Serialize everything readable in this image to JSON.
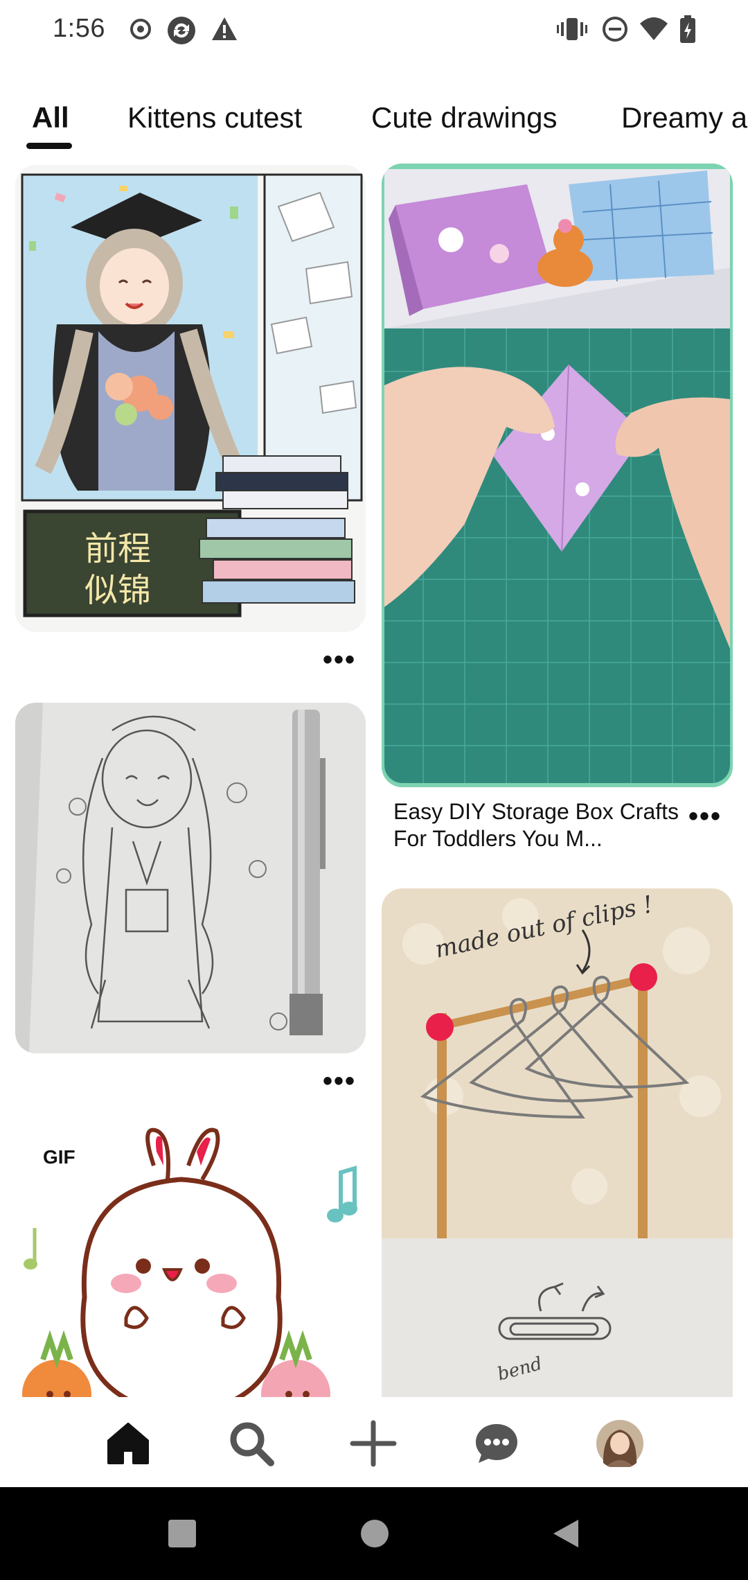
{
  "status_bar": {
    "time": "1:56",
    "left_icons": [
      "record-icon",
      "sync-icon",
      "warning-icon"
    ],
    "right_icons": [
      "vibrate-icon",
      "do-not-disturb-icon",
      "wifi-icon",
      "battery-icon"
    ]
  },
  "tabs": [
    {
      "label": "All",
      "selected": true
    },
    {
      "label": "Kittens cutest",
      "selected": false
    },
    {
      "label": "Cute drawings",
      "selected": false
    },
    {
      "label": "Dreamy a",
      "selected": false
    }
  ],
  "pins": [
    {
      "id": "graduation-illustration",
      "column": "left",
      "chars": "前程似锦",
      "has_title": false
    },
    {
      "id": "storage-box-video",
      "column": "right",
      "title": "Easy DIY Storage Box Crafts For Toddlers You M...",
      "has_title": true
    },
    {
      "id": "pencil-sketch",
      "column": "left",
      "has_title": false
    },
    {
      "id": "paperclip-hangers",
      "column": "right",
      "annotation": "made out of clips !",
      "annotation2": "bend",
      "has_title": false
    },
    {
      "id": "bunny-gif",
      "column": "left",
      "badge": "GIF",
      "has_title": false
    }
  ],
  "more_glyph": "•••",
  "bottom_nav": {
    "items": [
      "home-icon",
      "search-icon",
      "create-icon",
      "messages-icon",
      "profile-avatar"
    ],
    "active": "home-icon"
  },
  "system_nav": [
    "recents-button",
    "home-button",
    "back-button"
  ],
  "colors": {
    "text": "#111111",
    "video_border": "#7dd3b0",
    "cutting_mat": "#2f8a7c",
    "bunny_outline": "#7a2e1a",
    "berry_red": "#e8204a"
  }
}
